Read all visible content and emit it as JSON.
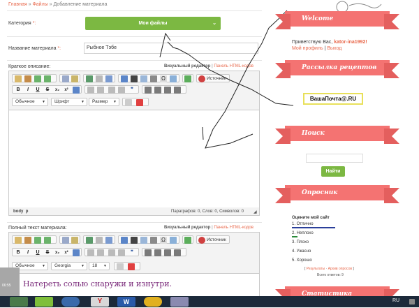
{
  "breadcrumb": {
    "home": "Главная",
    "sep": " » ",
    "files": "Файлы",
    "current": "Добавление материала"
  },
  "form": {
    "category_label": "Категория",
    "required_mark": "*:",
    "category_value": "Мои файлы",
    "name_label": "Название материала",
    "name_value": "Рыбное Тэбе",
    "short_label": "Краткое описание:",
    "full_label": "Полный текст материала:",
    "editor_visual": "Визуальный редактор",
    "editor_sep": " | ",
    "editor_html": "Панель HTML-кодов"
  },
  "editor1": {
    "source": "Источник",
    "format": "Обычное",
    "font": "Шрифт",
    "size": "Размер",
    "path_body": "body",
    "path_p": "p",
    "stats": "Параграфов: 0, Слов: 0, Символов: 0"
  },
  "editor2": {
    "source": "Источник",
    "format": "Обычное",
    "font": "Georgia",
    "size": "18",
    "content": "Натереть солью снаружи и изнутри."
  },
  "sidebar": {
    "welcome_title": "Welcome",
    "greeting": "Приветствую Вас,",
    "username": "kator-ina1992!",
    "profile": "Мой профиль",
    "sep": " | ",
    "logout": "Выход",
    "recipes_title": "Рассылка рецептов",
    "email_btn": "ВашаПочта@.RU",
    "search_title": "Поиск",
    "search_btn": "Найти",
    "poll_title": "Опросник",
    "poll_question": "Оцените мой сайт",
    "poll_options": [
      "1. Отлично",
      "2. Неплохо",
      "3. Плохо",
      "4. Ужасно",
      "5. Хорошо"
    ],
    "results": "Результаты",
    "archive": "Архив опросов",
    "total": "Всего ответов: 9",
    "stats_title": "Статистика"
  },
  "left_panel_text": "06:55",
  "tray": {
    "lang": "RU"
  },
  "colors": {
    "green": "#7cb842",
    "ribbon": "#f47372",
    "link": "#e8674a",
    "taskbar": "#1c2a3a"
  }
}
